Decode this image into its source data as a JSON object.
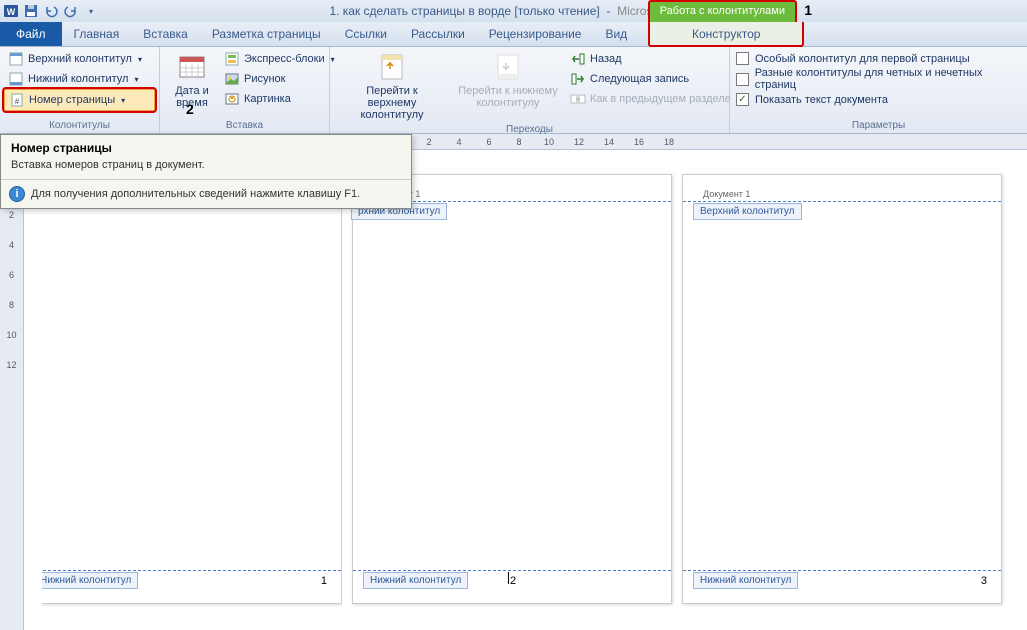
{
  "title": {
    "doc": "1. как сделать страницы в ворде [только чтение]",
    "app": "Microsoft Word"
  },
  "annot": {
    "one": "1",
    "two": "2"
  },
  "context_group": "Работа с колонтитулами",
  "context_tab": "Конструктор",
  "tabs": {
    "file": "Файл",
    "home": "Главная",
    "insert": "Вставка",
    "layout": "Разметка страницы",
    "refs": "Ссылки",
    "mail": "Рассылки",
    "review": "Рецензирование",
    "view": "Вид"
  },
  "ribbon": {
    "group1": {
      "label": "Колонтитулы",
      "header": "Верхний колонтитул",
      "footer": "Нижний колонтитул",
      "pagenum": "Номер страницы"
    },
    "group2": {
      "label": "Вставка",
      "datetime": "Дата и время",
      "express": "Экспресс-блоки",
      "picture": "Рисунок",
      "clipart": "Картинка"
    },
    "group3": {
      "label": "Переходы",
      "goheader": "Перейти к верхнему колонтитулу",
      "gofooter": "Перейти к нижнему колонтитулу",
      "back": "Назад",
      "next": "Следующая запись",
      "linkprev": "Как в предыдущем разделе"
    },
    "group4": {
      "label": "Параметры",
      "firstpage": "Особый колонтитул для первой страницы",
      "oddeven": "Разные колонтитулы для четных и нечетных страниц",
      "showtext": "Показать текст документа"
    }
  },
  "tooltip": {
    "title": "Номер страницы",
    "body": "Вставка номеров страниц в документ.",
    "footer": "Для получения дополнительных сведений нажмите клавишу F1."
  },
  "ruler_nums": [
    "2",
    "4",
    "6",
    "8",
    "10",
    "12",
    "14",
    "16",
    "18"
  ],
  "vruler_nums": [
    "2",
    "4",
    "6",
    "8",
    "10",
    "12"
  ],
  "pages": {
    "doc_tag": "Документ 1",
    "header_tab": "Верхний колонтитул",
    "header_tab_clip": "рхний колонтитул",
    "footer_tab": "Нижний колонтитул",
    "p1_num": "1",
    "p2_num": "2",
    "p3_num": "3"
  }
}
